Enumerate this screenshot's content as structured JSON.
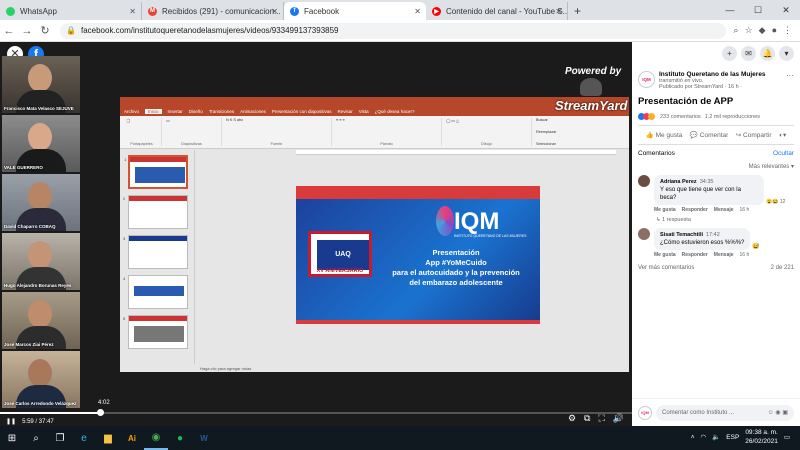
{
  "browser": {
    "tabs": [
      {
        "label": "WhatsApp",
        "fav_color": "#25d366",
        "active": false
      },
      {
        "label": "Recibidos (291) - comunicacion...",
        "fav_color": "#ea4335",
        "active": false
      },
      {
        "label": "Facebook",
        "fav_color": "#1877f2",
        "active": true
      },
      {
        "label": "Contenido del canal - YouTube S...",
        "fav_color": "#ff0000",
        "active": false
      }
    ],
    "url": "facebook.com/institutoqueretanodelasmujeres/videos/933499137393859"
  },
  "video": {
    "powered_by": "Powered by",
    "streamyard": "StreamYard",
    "participants": [
      {
        "name": "Francisco Mata Velasco SEJUVE"
      },
      {
        "name": "VALE GUERRERO"
      },
      {
        "name": "David Chaparro COBAQ"
      },
      {
        "name": "Hugo Alejandro Borunas Reyes"
      },
      {
        "name": "José Marcos Ziai Pérez"
      },
      {
        "name": "José Carlos Arredondo Velázquez"
      }
    ],
    "time_remaining": "4:02",
    "time_elapsed": "5:59 / 37:47",
    "progress": 0.158
  },
  "ppt": {
    "menu": [
      "Archivo",
      "Inicio",
      "Insertar",
      "Diseño",
      "Transiciones",
      "Animaciones",
      "Presentación con diapositivas",
      "Revisar",
      "Vista",
      "¿Qué desea hacer?"
    ],
    "groups": [
      "Portapapeles",
      "Diapositivas",
      "Fuente",
      "Párrafo",
      "Dibujo",
      "Edición"
    ],
    "edit_items": [
      "Buscar",
      "Reemplazar",
      "Seleccionar"
    ],
    "status": "Haga clic para agregar notas",
    "slide_numbers": [
      "1",
      "2",
      "3",
      "4",
      "5",
      "6"
    ],
    "slide": {
      "logo_left": "UAQ",
      "aniversario": "XV ANIVERSARIO",
      "iqm": "IQM",
      "iqm_sub": "INSTITUTO QUERETANO DE LAS MUJERES",
      "title_line1": "Presentación",
      "title_line2": "App #YoMeCuido",
      "title_line3": "para el autocuidado y la prevención",
      "title_line4": "del embarazo adolescente"
    }
  },
  "panel": {
    "page_name": "Instituto Queretano de las Mujeres",
    "status": "transmitió en vivo.",
    "meta": "Publicado por StreamYard · 16 h ·",
    "post_title": "Presentación de APP",
    "comments_count": "233 comentarios",
    "views": "1.2 mil reproducciones",
    "like_label": "Me gusta",
    "comment_label": "Comentar",
    "share_label": "Compartir",
    "comments_header": "Comentarios",
    "hide_label": "Ocultar",
    "relevant_label": "Más relevantes",
    "comments": [
      {
        "author": "Adriana Perez",
        "time": "34:35",
        "text": "Y eso que tiene que ver con la beca?",
        "reactions": "12",
        "replies": "1 respuesta",
        "like": "Me gusta",
        "reply": "Responder",
        "msg": "Mensaje",
        "ago": "16 h"
      },
      {
        "author": "Sisati Temachtili",
        "time": "17:42",
        "text": "¿Cómo estuvieron esos %%%?",
        "reactions": "",
        "replies": "",
        "like": "Me gusta",
        "reply": "Responder",
        "msg": "Mensaje",
        "ago": "16 h"
      }
    ],
    "more_comments": "Ver más comentarios",
    "page_count": "2 de 221",
    "comment_placeholder": "Comentar como Instituto ...",
    "page_logo": "IQM"
  },
  "taskbar": {
    "time": "09:38 a. m.",
    "date": "26/02/2021",
    "lang": "ESP"
  }
}
